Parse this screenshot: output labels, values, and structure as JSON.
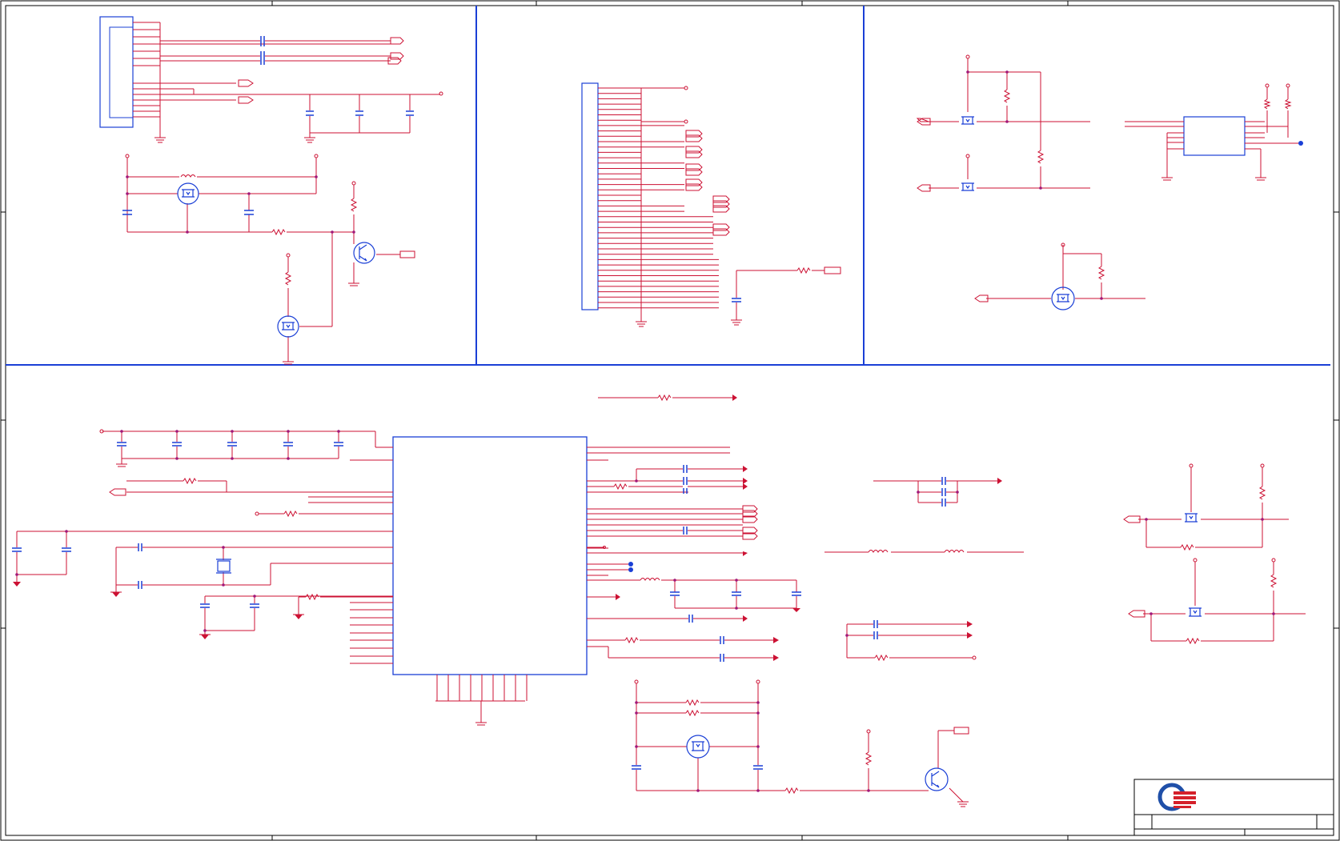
{
  "sheet": {
    "colors": {
      "wire": "#cc1133",
      "net": "#a0177a",
      "component": "#1a3fd6",
      "frame": "#1a3fd6",
      "junction": "#d4246b",
      "border": "#000000",
      "logo_red": "#d4202a",
      "logo_blue": "#1f4fa8"
    }
  },
  "title_block": {
    "logo": "company-logo-icon"
  }
}
